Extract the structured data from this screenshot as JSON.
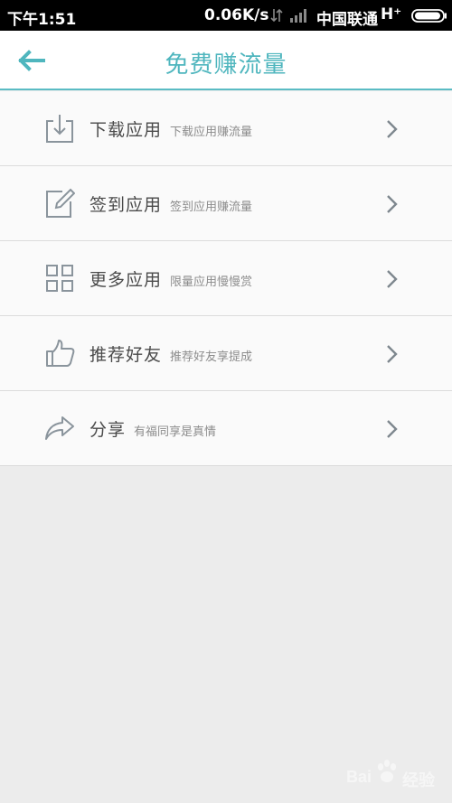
{
  "status_bar": {
    "time": "下午1:51",
    "speed": "0.06K/s",
    "carrier": "中国联通",
    "network_type": "H⁺"
  },
  "header": {
    "title": "免费赚流量",
    "back_icon": "arrow-left-icon"
  },
  "colors": {
    "accent": "#4fb6be",
    "icon_gray": "#8a949c",
    "background": "#ececec"
  },
  "list": {
    "items": [
      {
        "title": "下载应用",
        "subtitle": "下载应用赚流量",
        "icon": "download-icon"
      },
      {
        "title": "签到应用",
        "subtitle": "签到应用赚流量",
        "icon": "edit-icon"
      },
      {
        "title": "更多应用",
        "subtitle": "限量应用慢慢赏",
        "icon": "grid-icon"
      },
      {
        "title": "推荐好友",
        "subtitle": "推荐好友享提成",
        "icon": "thumbs-up-icon"
      },
      {
        "title": "分享",
        "subtitle": "有福同享是真情",
        "icon": "share-icon"
      }
    ]
  },
  "watermark": {
    "text_left": "Bai",
    "text_right": "经验"
  }
}
